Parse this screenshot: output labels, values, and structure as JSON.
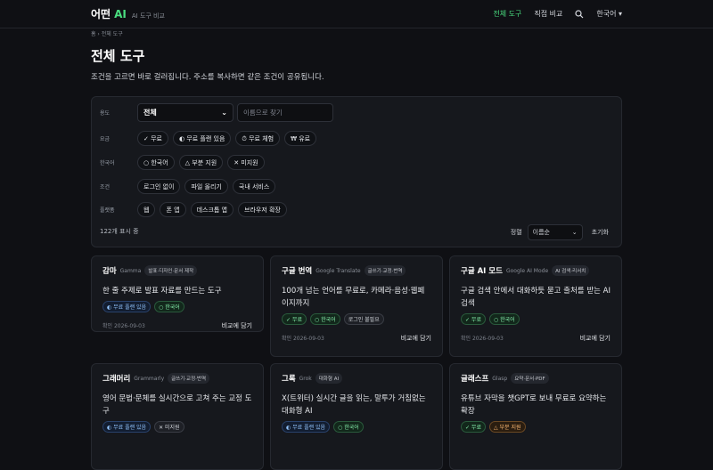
{
  "header": {
    "brand_main": "어떤",
    "brand_ai": "AI",
    "brand_sub": "AI 도구 비교",
    "nav": [
      "전체 도구",
      "직접 비교"
    ],
    "lang": "한국어 ▾"
  },
  "breadcrumb": "홈 › 전체 도구",
  "title": "전체 도구",
  "lead": "조건을 고르면 바로 걸러집니다. 주소를 복사하면 같은 조건이 공유됩니다.",
  "filters": {
    "purpose_label": "용도",
    "purpose_value": "전체",
    "name_placeholder": "이름으로 찾기",
    "price_label": "요금",
    "price_chips": [
      "✓ 무료",
      "◐ 무료 플랜 있음",
      "⏱ 무료 체험",
      "₩ 유료"
    ],
    "korean_label": "한국어",
    "korean_chips": [
      "○ 한국어",
      "△ 부분 지원",
      "✕ 미지원"
    ],
    "cond_label": "조건",
    "cond_chips": [
      "로그인 없이",
      "파일 올리기",
      "국내 서비스"
    ],
    "platform_label": "플랫폼",
    "platform_chips": [
      "웹",
      "폰 앱",
      "데스크톱 앱",
      "브라우저 확장"
    ],
    "count": "122개 표시 중",
    "sort_label": "정렬",
    "sort_value": "이름순",
    "reset": "초기화"
  },
  "cards": [
    {
      "name": "감마",
      "en": "Gamma",
      "tag": "발표·디자인·문서 제작",
      "desc": "한 줄 주제로 발표 자료를 만드는 도구",
      "badges": [
        {
          "t": "◐ 무료 플랜 있음",
          "c": "b-blue"
        },
        {
          "t": "○ 한국어",
          "c": "b-green"
        }
      ],
      "date": "확인 2026-09-03",
      "compare": "비교에 담기"
    },
    {
      "name": "구글 번역",
      "en": "Google Translate",
      "tag": "글쓰기·교정·번역",
      "desc": "100개 넘는 언어를 무료로, 카메라·음성·웹페이지까지",
      "badges": [
        {
          "t": "✓ 무료",
          "c": "b-green"
        },
        {
          "t": "○ 한국어",
          "c": "b-green"
        },
        {
          "t": "로그인 불필요",
          "c": "b-gray"
        }
      ],
      "date": "확인 2026-09-03",
      "compare": "비교에 담기"
    },
    {
      "name": "구글 AI 모드",
      "en": "Google AI Mode",
      "tag": "AI 검색·리서치",
      "desc": "구글 검색 안에서 대화하듯 묻고 출처를 받는 AI 검색",
      "badges": [
        {
          "t": "✓ 무료",
          "c": "b-green"
        },
        {
          "t": "○ 한국어",
          "c": "b-green"
        }
      ],
      "date": "확인 2026-09-03",
      "compare": "비교에 담기"
    },
    {
      "name": "그래머리",
      "en": "Grammarly",
      "tag": "글쓰기·교정·번역",
      "desc": "영어 문법·문체를 실시간으로 고쳐 주는 교정 도구",
      "badges": [
        {
          "t": "◐ 무료 플랜 있음",
          "c": "b-blue"
        },
        {
          "t": "✕ 미지원",
          "c": "b-gray"
        }
      ],
      "date": "",
      "compare": ""
    },
    {
      "name": "그록",
      "en": "Grok",
      "tag": "대화형 AI",
      "desc": "X(트위터) 실시간 글을 읽는, 말투가 거침없는 대화형 AI",
      "badges": [
        {
          "t": "◐ 무료 플랜 있음",
          "c": "b-blue"
        },
        {
          "t": "○ 한국어",
          "c": "b-green"
        }
      ],
      "date": "",
      "compare": ""
    },
    {
      "name": "글래스프",
      "en": "Glasp",
      "tag": "요약·문서·PDF",
      "desc": "유튜브 자막을 챗GPT로 보내 무료로 요약하는 확장",
      "badges": [
        {
          "t": "✓ 무료",
          "c": "b-green"
        },
        {
          "t": "△ 부분 지원",
          "c": "b-orange"
        }
      ],
      "date": "",
      "compare": ""
    }
  ]
}
